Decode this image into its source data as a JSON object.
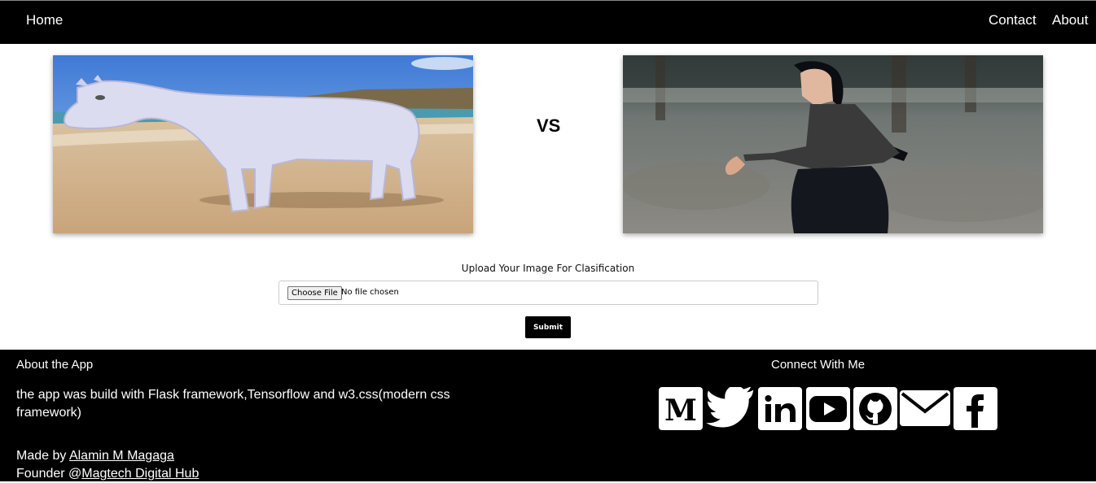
{
  "nav": {
    "home": "Home",
    "contact": "Contact",
    "about": "About"
  },
  "compare": {
    "vs": "VS"
  },
  "upload": {
    "label": "Upload Your Image For Clasification",
    "choose_button": "Choose File",
    "status": "No file chosen",
    "submit": "Submit"
  },
  "footer": {
    "about_title": "About the App",
    "about_text": "the app was build with Flask framework,Tensorflow and w3.css(modern css framework)",
    "made_by_prefix": "Made by ",
    "made_by_name": "Alamin M Magaga",
    "founder_prefix": "Founder @",
    "founder_org": "Magtech Digital Hub",
    "connect_title": "Connect With Me",
    "social": [
      "medium-icon",
      "twitter-icon",
      "linkedin-icon",
      "youtube-icon",
      "github-icon",
      "email-icon",
      "facebook-icon"
    ]
  }
}
